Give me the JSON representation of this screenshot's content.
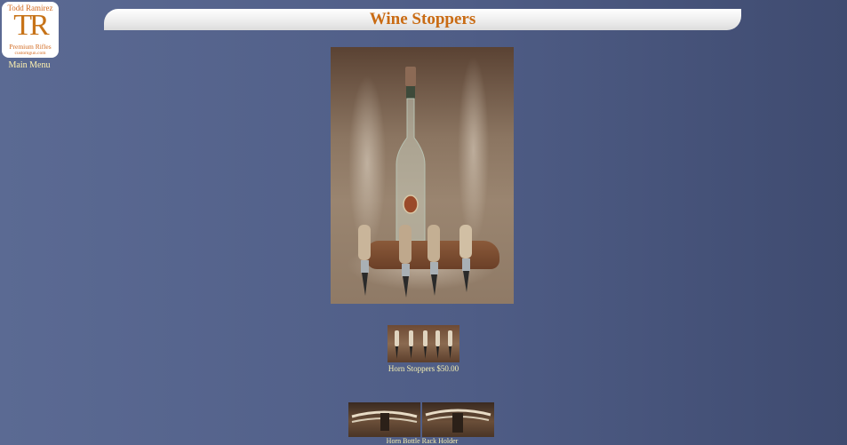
{
  "logo": {
    "name": "Todd Ramirez",
    "monogram": "TR",
    "tagline": "Premium Rifles",
    "url": "customgun.com"
  },
  "nav": {
    "main_menu": "Main Menu"
  },
  "page": {
    "title": "Wine Stoppers"
  },
  "gallery": {
    "caption_1": "Horn Stoppers $50.00",
    "caption_2": "Horn Bottle Rack Holder"
  },
  "colors": {
    "title": "#c96b13",
    "caption": "#f5efb0",
    "background": "#4f5d86"
  }
}
